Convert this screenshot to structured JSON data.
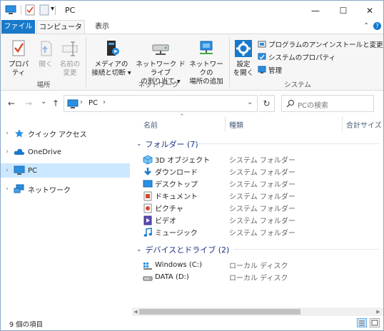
{
  "window": {
    "title": "PC",
    "quick_access_arrow": "▾",
    "minimize": "—",
    "maximize": "☐",
    "close": "✕"
  },
  "tabs": {
    "file": "ファイル",
    "computer": "コンピューター",
    "view": "表示",
    "collapse": "⌃",
    "help": "?"
  },
  "ribbon": {
    "location": {
      "label": "場所",
      "properties": "プロパティ",
      "open": "開く",
      "rename": [
        "名前の",
        "変更"
      ]
    },
    "network": {
      "label": "ネットワーク",
      "media": [
        "メディアの",
        "接続と切断 ▾"
      ],
      "map_drive": [
        "ネットワーク ドライブ",
        "の割り当て ▾"
      ],
      "add_location": [
        "ネットワークの",
        "場所の追加"
      ]
    },
    "system": {
      "label": "システム",
      "settings": [
        "設定",
        "を開く"
      ],
      "uninstall": "プログラムのアンインストールと変更",
      "sys_props": "システムのプロパティ",
      "manage": "管理"
    }
  },
  "address": {
    "back": "←",
    "forward": "→",
    "recent": "⌄",
    "up": "↑",
    "path_sep": "›",
    "path": "PC",
    "path_end": "›",
    "dropdown": "⌄",
    "refresh": "↻",
    "search_placeholder": "PCの検索"
  },
  "nav": {
    "items": [
      {
        "label": "クイック アクセス",
        "chev": "›"
      },
      {
        "label": "OneDrive",
        "chev": "›"
      },
      {
        "label": "PC",
        "chev": "›"
      },
      {
        "label": "ネットワーク",
        "chev": "›"
      }
    ]
  },
  "columns": {
    "name": "名前",
    "type": "種類",
    "size": "合計サイズ",
    "sort": "⌃"
  },
  "groups": {
    "folders": {
      "title": "フォルダー (7)",
      "chev": "⌄"
    },
    "drives": {
      "title": "デバイスとドライブ (2)",
      "chev": "⌄"
    }
  },
  "folders": [
    {
      "name": "3D オブジェクト",
      "type": "システム フォルダー",
      "icon": "cube-icon"
    },
    {
      "name": "ダウンロード",
      "type": "システム フォルダー",
      "icon": "download-icon"
    },
    {
      "name": "デスクトップ",
      "type": "システム フォルダー",
      "icon": "desktop-icon"
    },
    {
      "name": "ドキュメント",
      "type": "システム フォルダー",
      "icon": "document-icon"
    },
    {
      "name": "ピクチャ",
      "type": "システム フォルダー",
      "icon": "picture-icon"
    },
    {
      "name": "ビデオ",
      "type": "システム フォルダー",
      "icon": "video-icon"
    },
    {
      "name": "ミュージック",
      "type": "システム フォルダー",
      "icon": "music-icon"
    }
  ],
  "drives": [
    {
      "name": "Windows (C:)",
      "type": "ローカル ディスク",
      "icon": "windows-drive-icon"
    },
    {
      "name": "DATA (D:)",
      "type": "ローカル ディスク",
      "icon": "drive-icon"
    }
  ],
  "scroll": {
    "left": "◀",
    "right": "▶"
  },
  "status": {
    "count": "9 個の項目"
  },
  "colors": {
    "accent": "#1979ca",
    "selection": "#cce8ff",
    "group_header": "#1e3287"
  }
}
